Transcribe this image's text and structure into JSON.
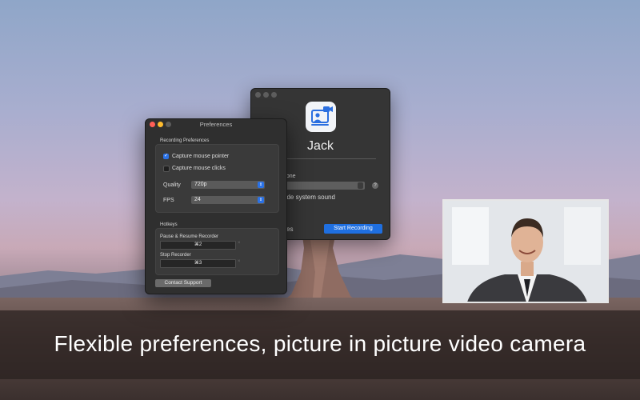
{
  "caption": "Flexible preferences, picture in picture video camera",
  "recorder_window": {
    "app_name": "Jack",
    "mic_label": "hone",
    "system_sound_label": "ude system sound",
    "preferences_link": "ces",
    "start_button": "Start Recording",
    "help": "?"
  },
  "preferences_window": {
    "title": "Preferences",
    "recording_section": "Recording Preferences",
    "options": {
      "capture_pointer": "Capture mouse pointer",
      "capture_clicks": "Capture mouse clicks",
      "capture_pointer_checked": true,
      "capture_clicks_checked": false
    },
    "quality_label": "Quality",
    "quality_value": "720p",
    "fps_label": "FPS",
    "fps_value": "24",
    "hotkeys_section": "Hotkeys",
    "pause_resume_label": "Pause & Resume Recorder",
    "pause_resume_key": "⌘2",
    "stop_label": "Stop Recorder",
    "stop_key": "⌘3",
    "clear_icon": "×",
    "contact_button": "Contact Support"
  },
  "colors": {
    "accent": "#1f6fe0",
    "window_bg": "#2f2f2f",
    "close": "#ff5f57",
    "minimize": "#febc2e",
    "zoom_inactive": "#5c5c5c"
  },
  "icons": [
    "camera-app-icon",
    "help-icon",
    "chevron-updown-icon",
    "clear-icon",
    "checkmark-icon"
  ]
}
